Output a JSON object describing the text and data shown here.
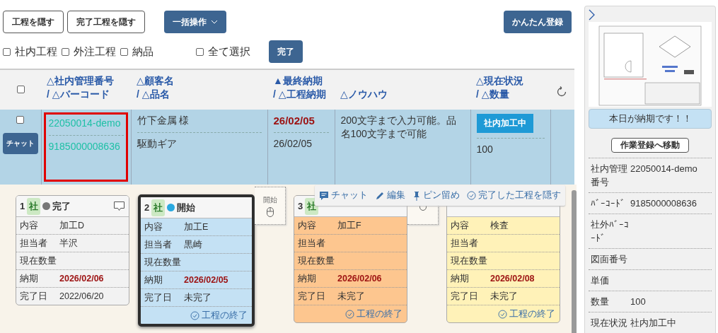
{
  "top_buttons": [
    {
      "label": "工程を隠す",
      "kind": "outline"
    },
    {
      "label": "完了工程を隠す",
      "kind": "outline"
    },
    {
      "label": "一括操作",
      "kind": "dropdown"
    }
  ],
  "quick_register_button": "かんたん登録",
  "filters": [
    {
      "label": "社内工程",
      "checked": false
    },
    {
      "label": "外注工程",
      "checked": false
    },
    {
      "label": "納品",
      "checked": false
    }
  ],
  "select_all": {
    "label": "全て選択",
    "checked": false
  },
  "complete_button": "完了",
  "table": {
    "header_checked": false,
    "columns": [
      {
        "lines": [
          "△社内管理番号",
          "/ △バーコード"
        ]
      },
      {
        "lines": [
          "△顧客名",
          "/ △品名"
        ]
      },
      {
        "lines": [
          "▲最終納期",
          "/ △工程納期"
        ]
      },
      {
        "lines": [
          "△ノウハウ"
        ]
      },
      {
        "lines": [
          "△現在状況",
          "/ △数量"
        ]
      }
    ],
    "rows": [
      {
        "checked": false,
        "chat_button": "チャット",
        "highlighted": true,
        "management_no": "22050014-demo",
        "barcode": "9185000008636",
        "customer": "竹下金属 様",
        "product": "駆動ギア",
        "final_due": "26/02/05",
        "process_due": "26/02/05",
        "knowhow": "200文字まで入力可能。品名100文字まで可能",
        "status": "社内加工中",
        "quantity": "100"
      }
    ]
  },
  "cards": [
    {
      "number": "1",
      "badge": "社",
      "status": "完了",
      "color": "#777777",
      "kind": "done",
      "selected": false,
      "chat": true,
      "slot": false,
      "fields": [
        {
          "label": "内容",
          "value": "加工D"
        },
        {
          "label": "担当者",
          "value": "半沢"
        },
        {
          "label": "現在数量"
        },
        {
          "label": "納期",
          "value": "2026/02/06",
          "kind": "due"
        },
        {
          "label": "完了日",
          "value": "2022/06/20"
        }
      ]
    },
    {
      "number": "2",
      "badge": "社",
      "status": "開始",
      "color": "#2aa9e0",
      "kind": "current",
      "selected": true,
      "chat": false,
      "slot": true,
      "slot_label": "開始",
      "finish": "工程の終了",
      "fields": [
        {
          "label": "内容",
          "value": "加工E"
        },
        {
          "label": "担当者",
          "value": "黒崎"
        },
        {
          "label": "現在数量"
        },
        {
          "label": "納期",
          "value": "2026/02/05",
          "kind": "due"
        },
        {
          "label": "完了日",
          "value": "未完了"
        }
      ]
    },
    {
      "number": "3",
      "badge": "社",
      "kind": "next",
      "selected": false,
      "chat": false,
      "slot": true,
      "finish": "工程の終了",
      "fields": [
        {
          "label": "内容",
          "value": "加工F"
        },
        {
          "label": "担当者"
        },
        {
          "label": "現在数量"
        },
        {
          "label": "納期",
          "value": "2026/02/06",
          "kind": "due"
        },
        {
          "label": "完了日",
          "value": "未完了"
        }
      ]
    },
    {
      "kind": "later",
      "selected": false,
      "chat": false,
      "slot": false,
      "finish": "工程の終了",
      "fields": [
        {
          "label": "内容",
          "value": "検査"
        },
        {
          "label": "担当者"
        },
        {
          "label": "現在数量"
        },
        {
          "label": "納期",
          "value": "2026/02/08",
          "kind": "due"
        },
        {
          "label": "完了日",
          "value": "未完了"
        }
      ]
    }
  ],
  "card_toolbar": [
    {
      "label": "チャット",
      "kind": "chat"
    },
    {
      "label": "編集",
      "kind": "edit"
    },
    {
      "label": "ピン留め",
      "kind": "pin"
    },
    {
      "label": "完了した工程を隠す",
      "kind": "hide"
    }
  ],
  "panel": {
    "due_notice": "本日が納期です！！",
    "work_button": "作業登録へ移動",
    "details": [
      {
        "label": "社内管理番号",
        "value": "22050014-demo"
      },
      {
        "label": "ﾊﾞｰｺｰﾄﾞ",
        "value": "9185000008636"
      },
      {
        "label": "社外ﾊﾞｰｺｰﾄﾞ"
      },
      {
        "label": "図面番号"
      },
      {
        "label": "単価"
      },
      {
        "label": "数量",
        "value": "100"
      },
      {
        "label": "現在状況",
        "value": "社内加工中"
      }
    ]
  }
}
